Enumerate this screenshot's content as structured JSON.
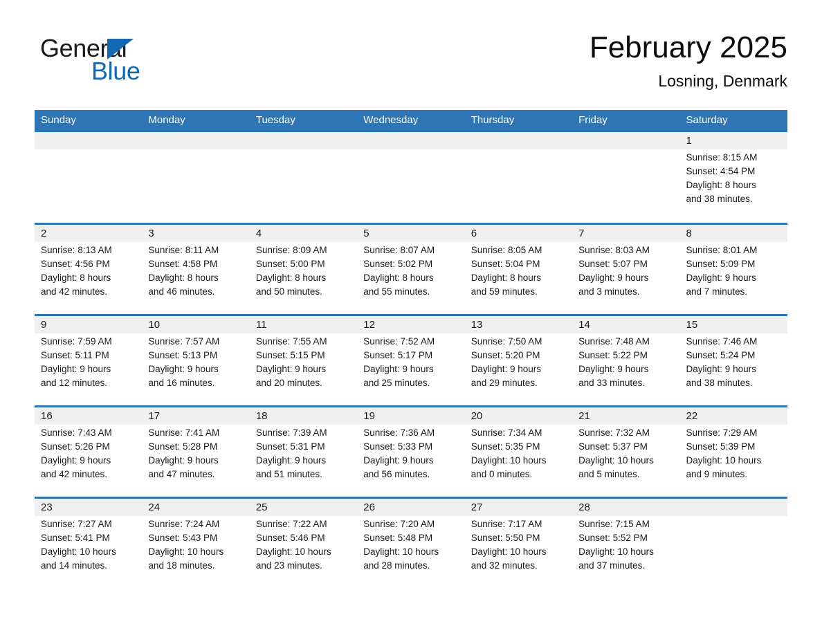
{
  "logo": {
    "word_black": "General",
    "word_blue": "Blue",
    "triangle_color": "#1268b3",
    "text_color": "#1a1a1a"
  },
  "header": {
    "title": "February 2025",
    "subtitle": "Losning, Denmark"
  },
  "theme": {
    "header_blue": "#2e75b6",
    "row_band_gray": "#f0f0f0",
    "text_color": "#1a1a1a"
  },
  "weekdays": [
    "Sunday",
    "Monday",
    "Tuesday",
    "Wednesday",
    "Thursday",
    "Friday",
    "Saturday"
  ],
  "weeks": [
    [
      {
        "day": "",
        "lines": []
      },
      {
        "day": "",
        "lines": []
      },
      {
        "day": "",
        "lines": []
      },
      {
        "day": "",
        "lines": []
      },
      {
        "day": "",
        "lines": []
      },
      {
        "day": "",
        "lines": []
      },
      {
        "day": "1",
        "lines": [
          "Sunrise: 8:15 AM",
          "Sunset: 4:54 PM",
          "Daylight: 8 hours",
          "and 38 minutes."
        ]
      }
    ],
    [
      {
        "day": "2",
        "lines": [
          "Sunrise: 8:13 AM",
          "Sunset: 4:56 PM",
          "Daylight: 8 hours",
          "and 42 minutes."
        ]
      },
      {
        "day": "3",
        "lines": [
          "Sunrise: 8:11 AM",
          "Sunset: 4:58 PM",
          "Daylight: 8 hours",
          "and 46 minutes."
        ]
      },
      {
        "day": "4",
        "lines": [
          "Sunrise: 8:09 AM",
          "Sunset: 5:00 PM",
          "Daylight: 8 hours",
          "and 50 minutes."
        ]
      },
      {
        "day": "5",
        "lines": [
          "Sunrise: 8:07 AM",
          "Sunset: 5:02 PM",
          "Daylight: 8 hours",
          "and 55 minutes."
        ]
      },
      {
        "day": "6",
        "lines": [
          "Sunrise: 8:05 AM",
          "Sunset: 5:04 PM",
          "Daylight: 8 hours",
          "and 59 minutes."
        ]
      },
      {
        "day": "7",
        "lines": [
          "Sunrise: 8:03 AM",
          "Sunset: 5:07 PM",
          "Daylight: 9 hours",
          "and 3 minutes."
        ]
      },
      {
        "day": "8",
        "lines": [
          "Sunrise: 8:01 AM",
          "Sunset: 5:09 PM",
          "Daylight: 9 hours",
          "and 7 minutes."
        ]
      }
    ],
    [
      {
        "day": "9",
        "lines": [
          "Sunrise: 7:59 AM",
          "Sunset: 5:11 PM",
          "Daylight: 9 hours",
          "and 12 minutes."
        ]
      },
      {
        "day": "10",
        "lines": [
          "Sunrise: 7:57 AM",
          "Sunset: 5:13 PM",
          "Daylight: 9 hours",
          "and 16 minutes."
        ]
      },
      {
        "day": "11",
        "lines": [
          "Sunrise: 7:55 AM",
          "Sunset: 5:15 PM",
          "Daylight: 9 hours",
          "and 20 minutes."
        ]
      },
      {
        "day": "12",
        "lines": [
          "Sunrise: 7:52 AM",
          "Sunset: 5:17 PM",
          "Daylight: 9 hours",
          "and 25 minutes."
        ]
      },
      {
        "day": "13",
        "lines": [
          "Sunrise: 7:50 AM",
          "Sunset: 5:20 PM",
          "Daylight: 9 hours",
          "and 29 minutes."
        ]
      },
      {
        "day": "14",
        "lines": [
          "Sunrise: 7:48 AM",
          "Sunset: 5:22 PM",
          "Daylight: 9 hours",
          "and 33 minutes."
        ]
      },
      {
        "day": "15",
        "lines": [
          "Sunrise: 7:46 AM",
          "Sunset: 5:24 PM",
          "Daylight: 9 hours",
          "and 38 minutes."
        ]
      }
    ],
    [
      {
        "day": "16",
        "lines": [
          "Sunrise: 7:43 AM",
          "Sunset: 5:26 PM",
          "Daylight: 9 hours",
          "and 42 minutes."
        ]
      },
      {
        "day": "17",
        "lines": [
          "Sunrise: 7:41 AM",
          "Sunset: 5:28 PM",
          "Daylight: 9 hours",
          "and 47 minutes."
        ]
      },
      {
        "day": "18",
        "lines": [
          "Sunrise: 7:39 AM",
          "Sunset: 5:31 PM",
          "Daylight: 9 hours",
          "and 51 minutes."
        ]
      },
      {
        "day": "19",
        "lines": [
          "Sunrise: 7:36 AM",
          "Sunset: 5:33 PM",
          "Daylight: 9 hours",
          "and 56 minutes."
        ]
      },
      {
        "day": "20",
        "lines": [
          "Sunrise: 7:34 AM",
          "Sunset: 5:35 PM",
          "Daylight: 10 hours",
          "and 0 minutes."
        ]
      },
      {
        "day": "21",
        "lines": [
          "Sunrise: 7:32 AM",
          "Sunset: 5:37 PM",
          "Daylight: 10 hours",
          "and 5 minutes."
        ]
      },
      {
        "day": "22",
        "lines": [
          "Sunrise: 7:29 AM",
          "Sunset: 5:39 PM",
          "Daylight: 10 hours",
          "and 9 minutes."
        ]
      }
    ],
    [
      {
        "day": "23",
        "lines": [
          "Sunrise: 7:27 AM",
          "Sunset: 5:41 PM",
          "Daylight: 10 hours",
          "and 14 minutes."
        ]
      },
      {
        "day": "24",
        "lines": [
          "Sunrise: 7:24 AM",
          "Sunset: 5:43 PM",
          "Daylight: 10 hours",
          "and 18 minutes."
        ]
      },
      {
        "day": "25",
        "lines": [
          "Sunrise: 7:22 AM",
          "Sunset: 5:46 PM",
          "Daylight: 10 hours",
          "and 23 minutes."
        ]
      },
      {
        "day": "26",
        "lines": [
          "Sunrise: 7:20 AM",
          "Sunset: 5:48 PM",
          "Daylight: 10 hours",
          "and 28 minutes."
        ]
      },
      {
        "day": "27",
        "lines": [
          "Sunrise: 7:17 AM",
          "Sunset: 5:50 PM",
          "Daylight: 10 hours",
          "and 32 minutes."
        ]
      },
      {
        "day": "28",
        "lines": [
          "Sunrise: 7:15 AM",
          "Sunset: 5:52 PM",
          "Daylight: 10 hours",
          "and 37 minutes."
        ]
      },
      {
        "day": "",
        "lines": []
      }
    ]
  ]
}
